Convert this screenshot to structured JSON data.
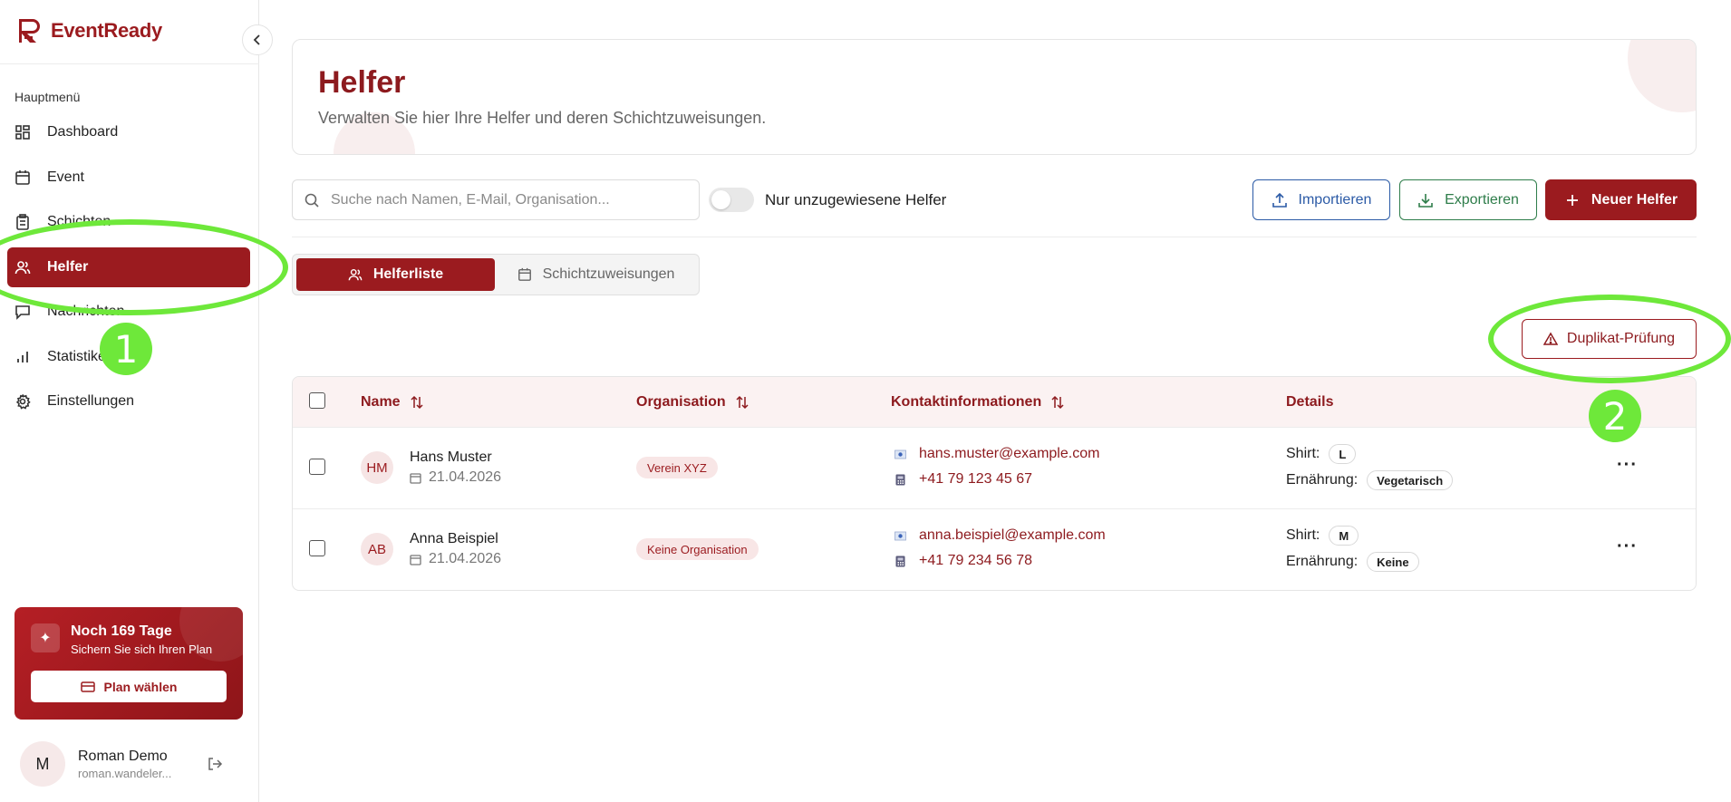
{
  "app": {
    "logo_text": "EventReady"
  },
  "sidebar": {
    "section_label": "Hauptmenü",
    "items": [
      {
        "label": "Dashboard",
        "icon": "dashboard-icon"
      },
      {
        "label": "Event",
        "icon": "calendar-icon"
      },
      {
        "label": "Schichten",
        "icon": "clipboard-icon"
      },
      {
        "label": "Helfer",
        "icon": "users-icon",
        "active": true
      },
      {
        "label": "Nachrichten",
        "icon": "message-icon"
      },
      {
        "label": "Statistiken",
        "icon": "bar-chart-icon"
      },
      {
        "label": "Einstellungen",
        "icon": "gear-icon"
      }
    ],
    "plan": {
      "title": "Noch 169 Tage",
      "subtitle": "Sichern Sie sich Ihren Plan",
      "button_label": "Plan wählen"
    },
    "user": {
      "initial": "M",
      "name": "Roman Demo",
      "email": "roman.wandeler..."
    }
  },
  "header": {
    "title": "Helfer",
    "subtitle": "Verwalten Sie hier Ihre Helfer und deren Schichtzuweisungen."
  },
  "toolbar": {
    "search_placeholder": "Suche nach Namen, E-Mail, Organisation...",
    "toggle_label": "Nur unzugewiesene Helfer",
    "import_label": "Importieren",
    "export_label": "Exportieren",
    "new_label": "Neuer Helfer"
  },
  "tabs": [
    {
      "label": "Helferliste",
      "active": true
    },
    {
      "label": "Schichtzuweisungen",
      "active": false
    }
  ],
  "duplicate_check_label": "Duplikat-Prüfung",
  "table": {
    "columns": [
      "Name",
      "Organisation",
      "Kontaktinformationen",
      "Details"
    ],
    "rows": [
      {
        "initials": "HM",
        "name": "Hans Muster",
        "date": "21.04.2026",
        "organisation": "Verein XYZ",
        "email": "hans.muster@example.com",
        "phone": "+41 79 123 45 67",
        "shirt_label": "Shirt:",
        "shirt": "L",
        "diet_label": "Ernährung:",
        "diet": "Vegetarisch"
      },
      {
        "initials": "AB",
        "name": "Anna Beispiel",
        "date": "21.04.2026",
        "organisation": "Keine Organisation",
        "email": "anna.beispiel@example.com",
        "phone": "+41 79 234 56 78",
        "shirt_label": "Shirt:",
        "shirt": "M",
        "diet_label": "Ernährung:",
        "diet": "Keine"
      }
    ]
  },
  "annotations": [
    "1",
    "2"
  ],
  "colors": {
    "brand": "#9b1b1f",
    "import": "#2b5aa6",
    "export": "#2e7d4a",
    "annotation": "#6ee83a"
  }
}
